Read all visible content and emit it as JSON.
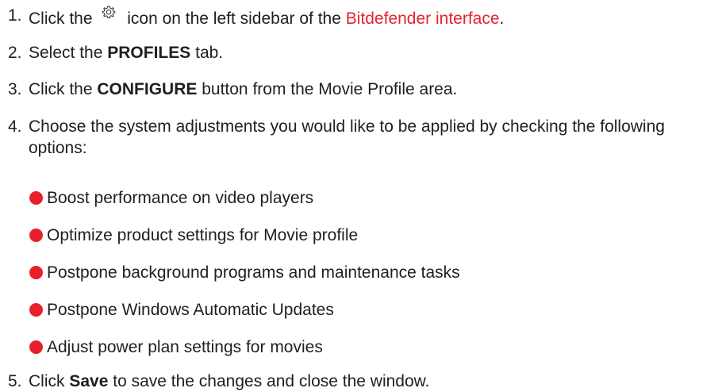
{
  "steps": {
    "s1": {
      "num": "1.",
      "before": "Click the",
      "icon": "gear-icon",
      "middle": "icon on the left sidebar of the",
      "link": "Bitdefender interface",
      "after": "."
    },
    "s2": {
      "num": "2.",
      "before": "Select the",
      "bold": "PROFILES",
      "after": "tab."
    },
    "s3": {
      "num": "3.",
      "before": "Click the",
      "bold": "CONFIGURE",
      "after": "button from the Movie Profile area."
    },
    "s4": {
      "num": "4.",
      "text": "Choose the system adjustments you would like to be applied by checking the following options:",
      "options": [
        "Boost performance on video players",
        "Optimize product settings for Movie profile",
        "Postpone background programs and maintenance tasks",
        "Postpone Windows Automatic Updates",
        "Adjust power plan settings for movies"
      ]
    },
    "s5": {
      "num": "5.",
      "before": "Click",
      "bold": "Save",
      "after": "to save the changes and close the window."
    }
  },
  "colors": {
    "link": "#e2242f",
    "bullet": "#e8202c",
    "text": "#1f1f1f"
  }
}
